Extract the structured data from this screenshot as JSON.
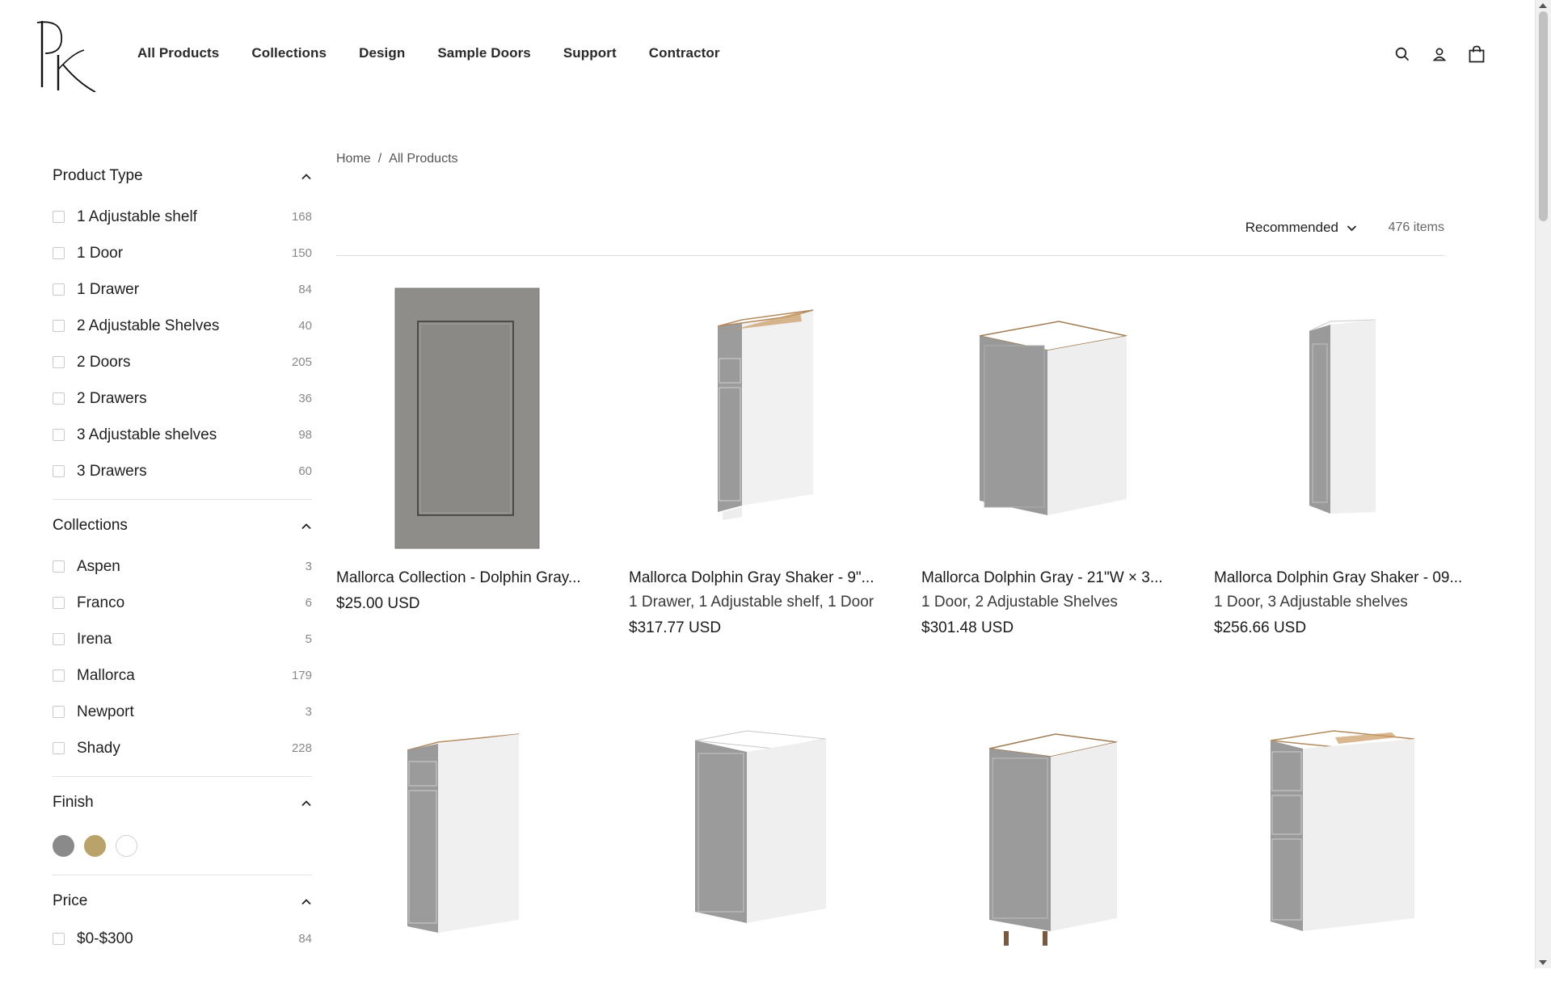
{
  "header": {
    "logo_text": "PK",
    "nav": [
      "All Products",
      "Collections",
      "Design",
      "Sample Doors",
      "Support",
      "Contractor"
    ],
    "icons": [
      "search-icon",
      "account-icon",
      "cart-icon"
    ]
  },
  "sidebar": {
    "product_type": {
      "title": "Product Type",
      "items": [
        {
          "label": "1 Adjustable shelf",
          "count": "168"
        },
        {
          "label": "1 Door",
          "count": "150"
        },
        {
          "label": "1 Drawer",
          "count": "84"
        },
        {
          "label": "2 Adjustable Shelves",
          "count": "40"
        },
        {
          "label": "2 Doors",
          "count": "205"
        },
        {
          "label": "2 Drawers",
          "count": "36"
        },
        {
          "label": "3 Adjustable shelves",
          "count": "98"
        },
        {
          "label": "3 Drawers",
          "count": "60"
        }
      ]
    },
    "collections": {
      "title": "Collections",
      "items": [
        {
          "label": "Aspen",
          "count": "3"
        },
        {
          "label": "Franco",
          "count": "6"
        },
        {
          "label": "Irena",
          "count": "5"
        },
        {
          "label": "Mallorca",
          "count": "179"
        },
        {
          "label": "Newport",
          "count": "3"
        },
        {
          "label": "Shady",
          "count": "228"
        }
      ]
    },
    "finish": {
      "title": "Finish",
      "swatches": [
        "#8a8a8a",
        "#b9a36a",
        "#ffffff"
      ]
    },
    "price": {
      "title": "Price",
      "items": [
        {
          "label": "$0-$300",
          "count": "84"
        }
      ]
    }
  },
  "breadcrumb": {
    "home": "Home",
    "separator": "/",
    "current": "All Products"
  },
  "toolbar": {
    "sort_label": "Recommended",
    "items_count": "476 items"
  },
  "products": [
    {
      "title": "Mallorca Collection - Dolphin Gray...",
      "subtitle": "",
      "price": "$25.00 USD"
    },
    {
      "title": "Mallorca Dolphin Gray Shaker - 9\"...",
      "subtitle": "1 Drawer, 1 Adjustable shelf, 1 Door",
      "price": "$317.77 USD"
    },
    {
      "title": "Mallorca Dolphin Gray - 21\"W × 3...",
      "subtitle": "1 Door, 2 Adjustable Shelves",
      "price": "$301.48 USD"
    },
    {
      "title": "Mallorca Dolphin Gray Shaker - 09...",
      "subtitle": "1 Door, 3 Adjustable shelves",
      "price": "$256.66 USD"
    }
  ],
  "colors": {
    "cabinet_gray": "#9a9a9a",
    "door_sample": "#8d8b87",
    "accent_text": "#1a1a1a"
  }
}
